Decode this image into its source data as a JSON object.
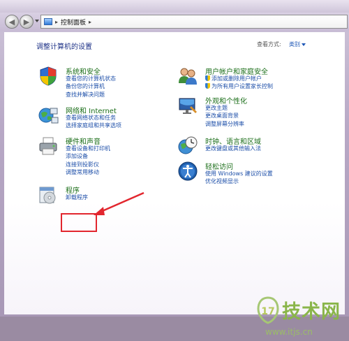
{
  "toolbar": {
    "breadcrumb_sep": "▸",
    "breadcrumb_current": "控制面板",
    "breadcrumb_trailing_sep": "▸"
  },
  "page": {
    "title": "调整计算机的设置",
    "view_by_label": "查看方式:",
    "view_by_value": "类别"
  },
  "categories": [
    {
      "title": "系统和安全",
      "icon": "shield-icon",
      "links": [
        "查看您的计算机状态",
        "备份您的计算机",
        "查找并解决问题"
      ]
    },
    {
      "title": "网络和 Internet",
      "icon": "network-globe-icon",
      "links": [
        "查看网络状态和任务",
        "选择家庭组和共享选项"
      ]
    },
    {
      "title": "硬件和声音",
      "icon": "printer-icon",
      "links": [
        "查看设备和打印机",
        "添加设备",
        "连接到投影仪",
        "调整常用移动"
      ]
    },
    {
      "title": "程序",
      "icon": "programs-icon",
      "links": [
        "卸载程序"
      ]
    },
    {
      "title": "用户帐户和家庭安全",
      "icon": "users-icon",
      "links": [
        "添加或删除用户帐户",
        "为所有用户设置家长控制"
      ]
    },
    {
      "title": "外观和个性化",
      "icon": "monitor-icon",
      "links": [
        "更改主题",
        "更改桌面背景",
        "调整屏幕分辨率"
      ]
    },
    {
      "title": "时钟、语言和区域",
      "icon": "clock-globe-icon",
      "links": [
        "更改键盘或其他输入法"
      ]
    },
    {
      "title": "轻松访问",
      "icon": "accessibility-icon",
      "links": [
        "使用 Windows 建议的设置",
        "优化视频显示"
      ]
    }
  ],
  "watermark": {
    "logo_text": "技术网",
    "url": "www.itjs.cn"
  },
  "colors": {
    "category_title": "#1b6e19",
    "link": "#1c4ea8",
    "highlight": "#e2262e"
  }
}
